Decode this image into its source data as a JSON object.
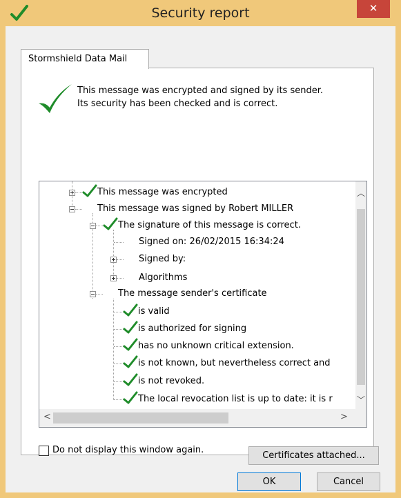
{
  "window": {
    "title": "Security report",
    "close_label": "✕"
  },
  "tab": {
    "label": "Stormshield Data Mail"
  },
  "summary": {
    "line1": "This message was encrypted and signed by its sender.",
    "line2": "Its security has been checked and is correct."
  },
  "tree": {
    "encrypted": "This message was encrypted",
    "signed": "This message was signed by Robert MILLER",
    "signature_correct": "The signature of this message is correct.",
    "signed_on": "Signed on: 26/02/2015 16:34:24",
    "signed_by": "Signed by:",
    "algorithms": "Algorithms",
    "certificate": "The message sender's certificate",
    "cert_valid": "is valid",
    "cert_authorized": "is authorized for signing",
    "cert_extension": "has no unknown critical extension.",
    "cert_known": "is not known, but nevertheless correct and",
    "cert_revoked": "is not revoked.",
    "cert_revocation_list": "The local revocation list is up to date: it is r"
  },
  "checkbox": {
    "label": "Do not display this window again.",
    "checked": false
  },
  "buttons": {
    "certificates": "Certificates attached...",
    "ok": "OK",
    "cancel": "Cancel"
  },
  "colors": {
    "title_bar": "#f0c87a",
    "check_green": "#1f8c2a",
    "close": "#c7453a"
  },
  "icons": {
    "check": "check-icon",
    "expand": "expand-plus-icon",
    "collapse": "collapse-minus-icon"
  }
}
